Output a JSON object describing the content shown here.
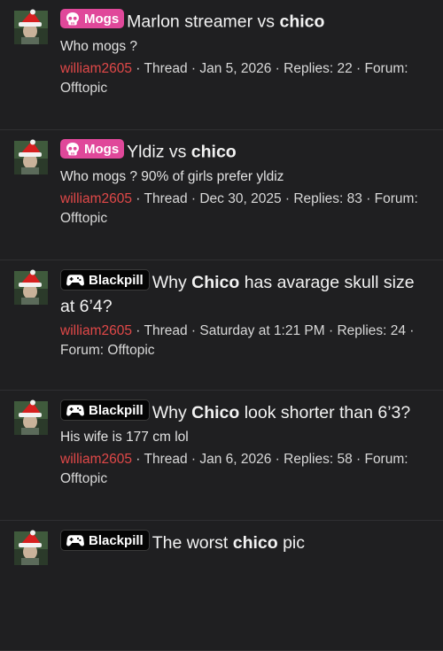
{
  "colors": {
    "background": "#1f1f21",
    "mogs_badge": "#e0489a",
    "blackpill_badge": "#050505",
    "username": "#e04848"
  },
  "results": [
    {
      "badge": "Mogs",
      "badge_icon": "skull-icon",
      "title_pre": "Marlon streamer vs ",
      "title_kw": "chico",
      "title_post": "",
      "snippet": "Who mogs ?",
      "user": "william2605",
      "meta": " · Thread · Jan 5, 2026 · Replies: 22 · Forum: Offtopic"
    },
    {
      "badge": "Mogs",
      "badge_icon": "skull-icon",
      "title_pre": "Yldiz vs ",
      "title_kw": "chico",
      "title_post": "",
      "snippet": "Who mogs ? 90% of girls prefer yldiz",
      "user": "william2605",
      "meta": " · Thread · Dec 30, 2025 · Replies: 83 · Forum: Offtopic"
    },
    {
      "badge": "Blackpill",
      "badge_icon": "gamepad-icon",
      "title_pre": "Why ",
      "title_kw": "Chico",
      "title_post": " has avarage skull size at 6’4?",
      "snippet": "",
      "user": "william2605",
      "meta": " · Thread · Saturday at 1:21 PM · Replies: 24 · Forum: Offtopic"
    },
    {
      "badge": "Blackpill",
      "badge_icon": "gamepad-icon",
      "title_pre": "Why ",
      "title_kw": "Chico",
      "title_post": " look shorter than 6’3?",
      "snippet": "His wife is 177 cm lol",
      "user": "william2605",
      "meta": " · Thread · Jan 6, 2026 · Replies: 58 · Forum: Offtopic"
    },
    {
      "badge": "Blackpill",
      "badge_icon": "gamepad-icon",
      "title_pre": "The worst ",
      "title_kw": "chico",
      "title_post": " pic",
      "snippet": "",
      "user": "",
      "meta": ""
    }
  ]
}
